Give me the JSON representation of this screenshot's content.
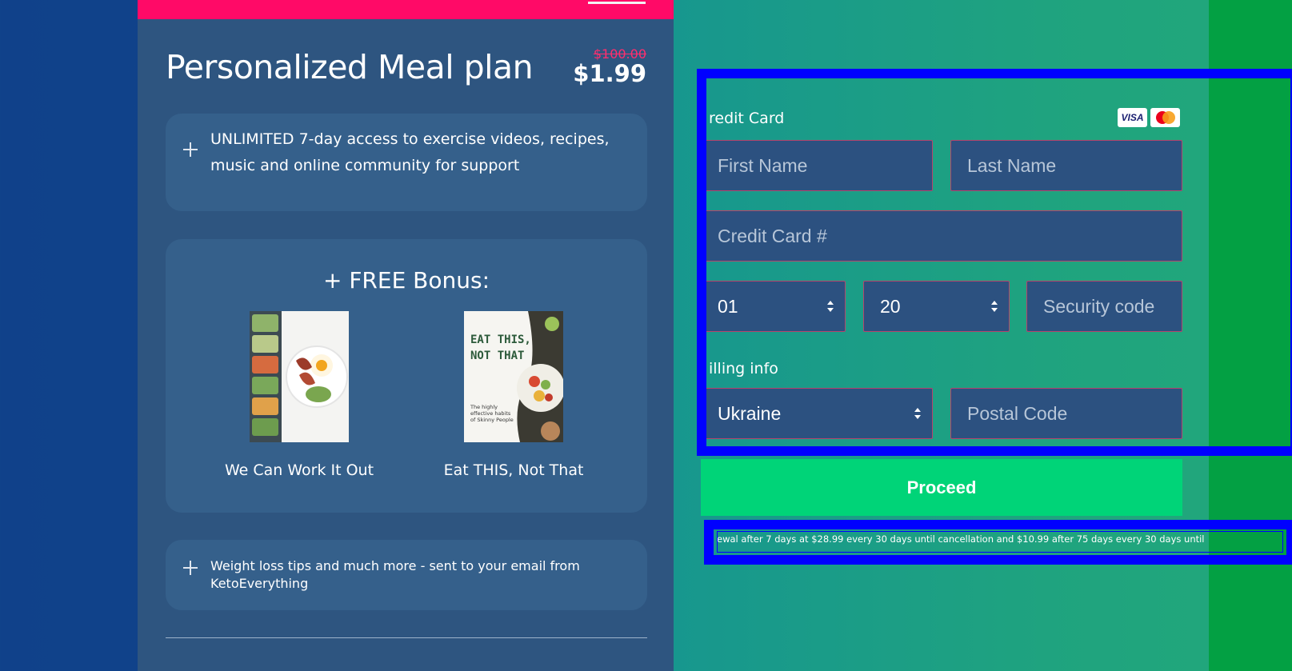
{
  "plan": {
    "title": "Personalized Meal plan",
    "old_price": "$100.00",
    "price": "$1.99"
  },
  "features": [
    {
      "text": "UNLIMITED 7-day access to exercise videos, recipes, music and online community for support"
    },
    {
      "text": "Weight loss tips and much more - sent to your email from KetoEverything"
    }
  ],
  "bonus": {
    "title": "+ FREE Bonus:",
    "books": [
      {
        "caption": "We Can Work It Out"
      },
      {
        "caption": "Eat THIS, Not That",
        "cover_title": "EAT THIS, NOT THAT",
        "cover_subtitle": "The highly effective habits of Skinny People"
      }
    ]
  },
  "payment": {
    "credit_card_label": "redit Card",
    "card_brands": [
      "VISA",
      "Mastercard"
    ],
    "first_name_placeholder": "First Name",
    "last_name_placeholder": "Last Name",
    "card_number_placeholder": "Credit Card #",
    "month_value": "01",
    "year_value": "20",
    "security_placeholder": "Security code",
    "billing_label": "illing info",
    "country_value": "Ukraine",
    "postal_placeholder": "Postal Code",
    "proceed_label": "Proceed",
    "disclaimer": "ewal after 7 days at $28.99 every 30 days until cancellation and $10.99 after 75 days every 30 days until"
  },
  "colors": {
    "accent_pink": "#ff0a67",
    "proceed_green": "#00d478",
    "overlay_blue": "#0000ff"
  }
}
